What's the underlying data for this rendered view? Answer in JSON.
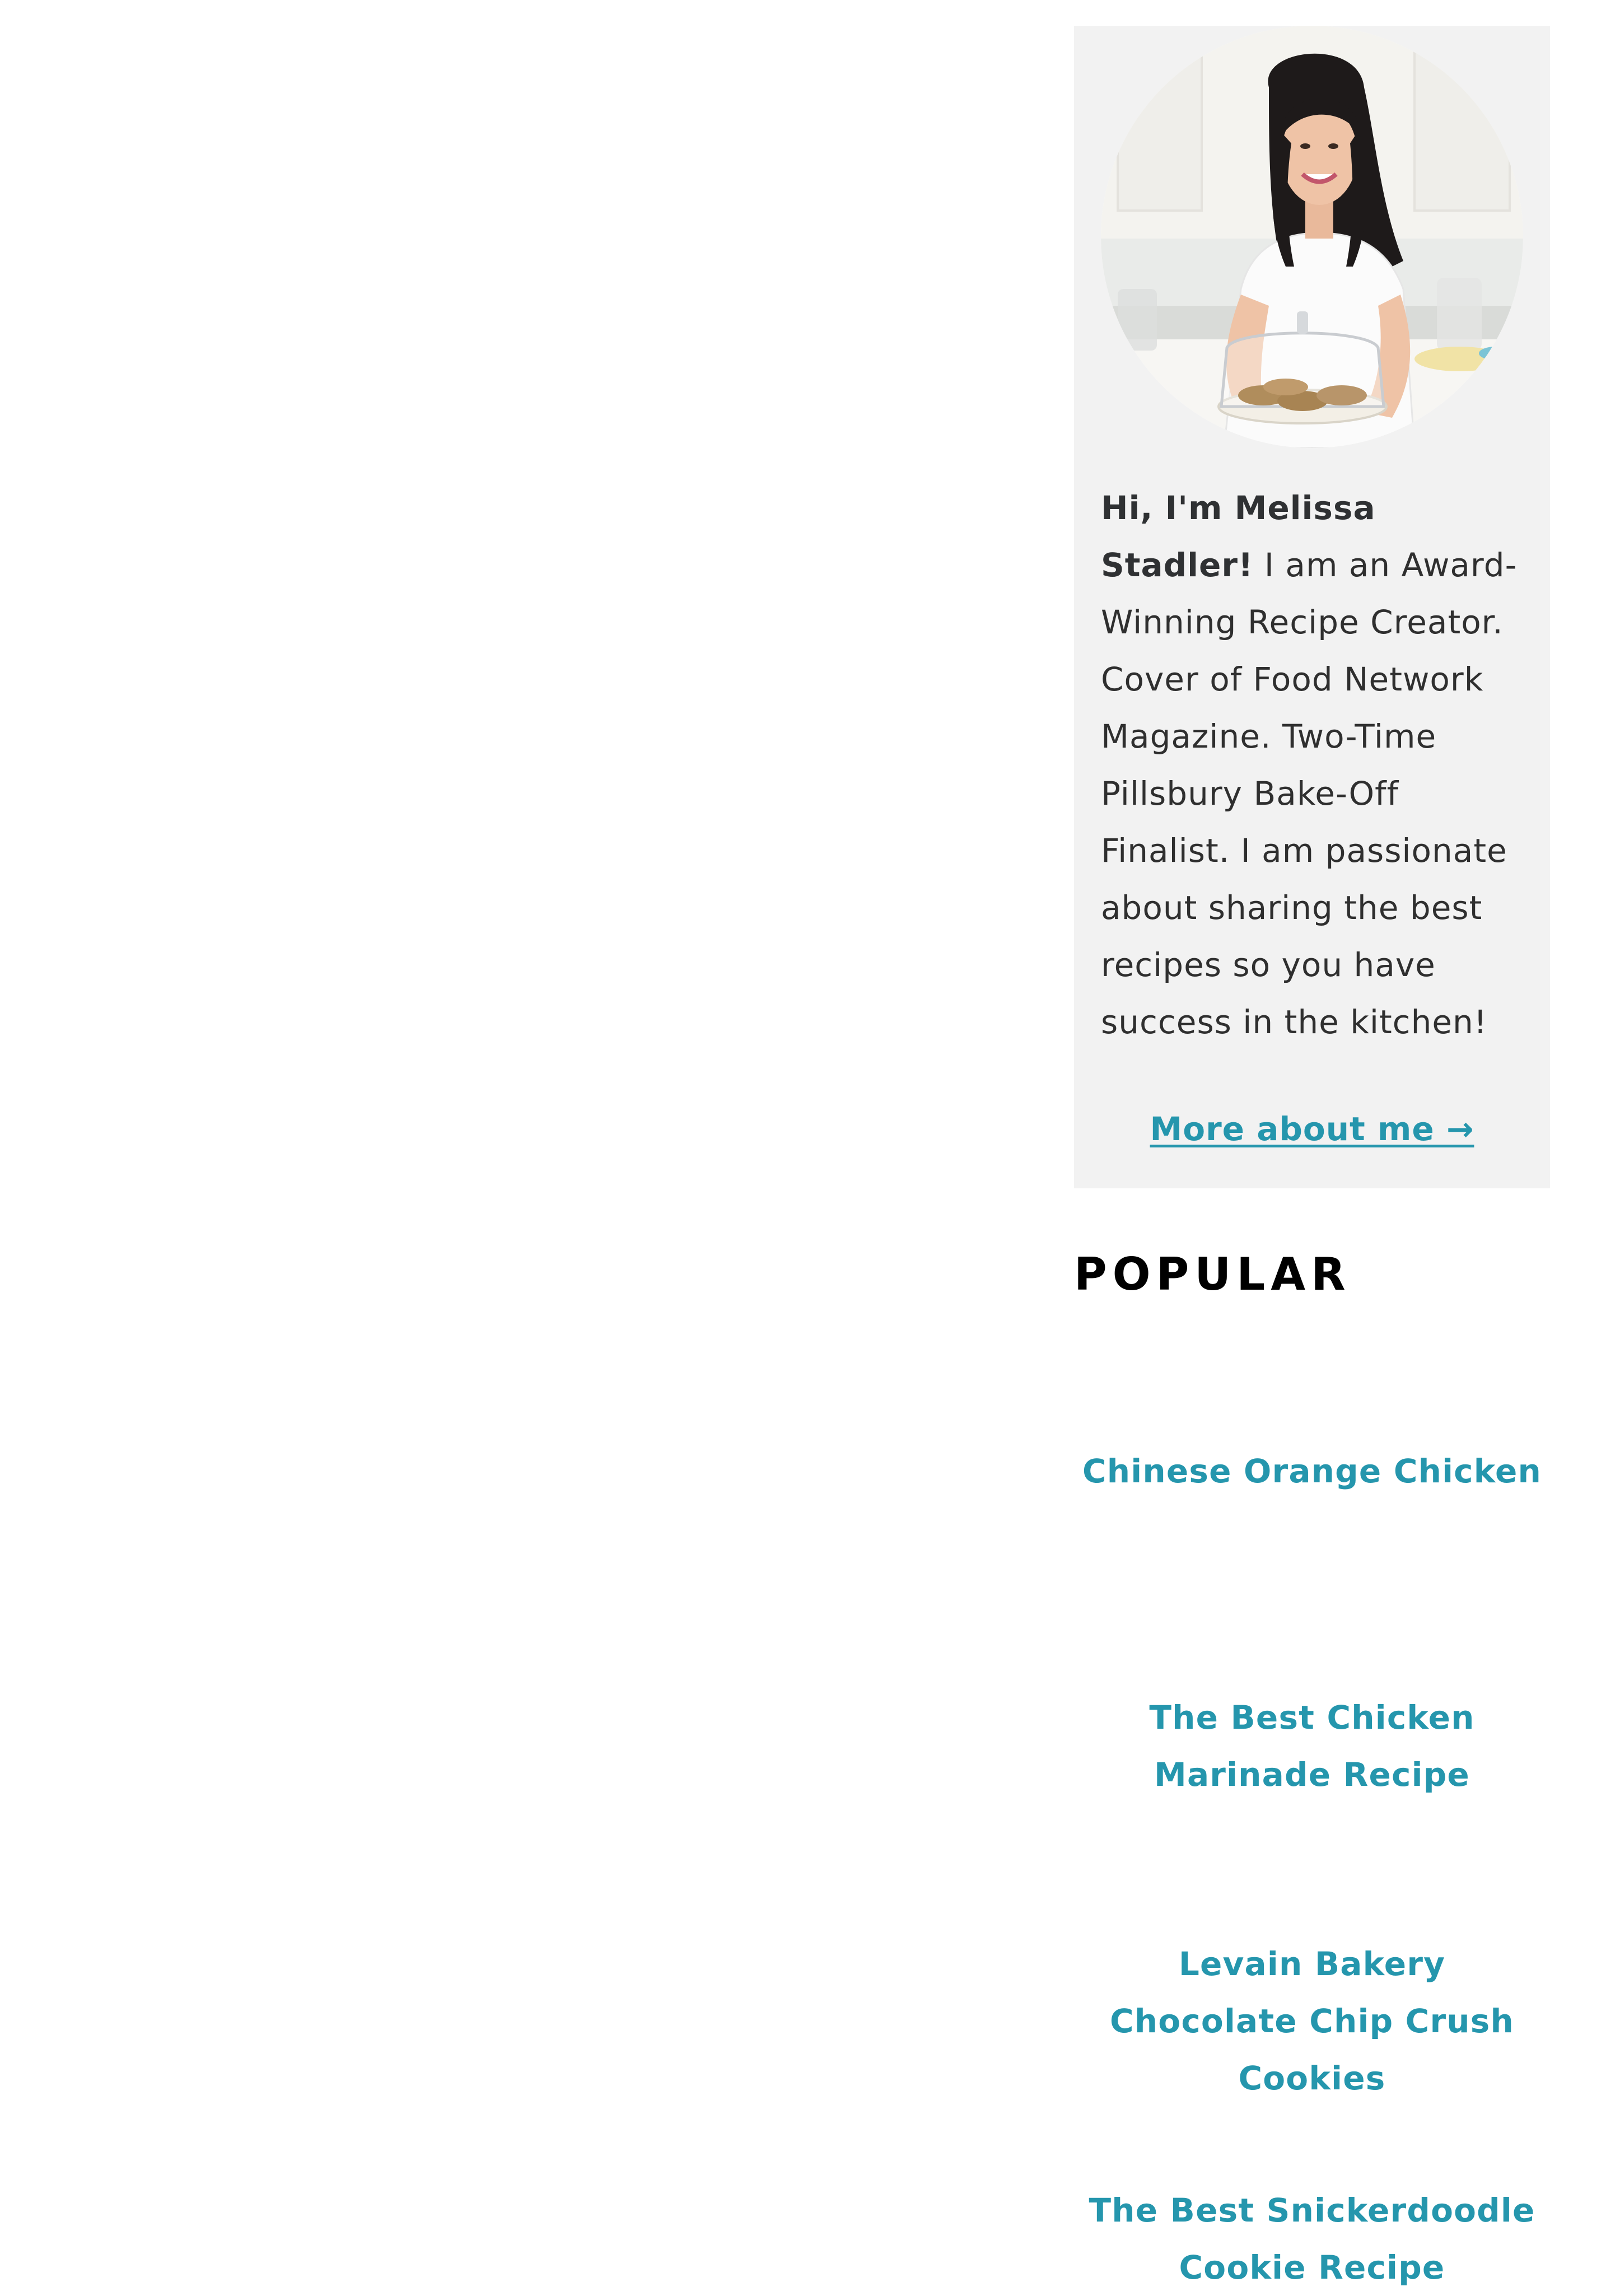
{
  "about": {
    "name_intro": "Hi, I'm Melissa Stadler!",
    "bio": " I am an Award-Winning Recipe Creator. Cover of Food Network Magazine. Two-Time Pillsbury Bake-Off Finalist. I am passionate about sharing the best recipes so you have success in the kitchen!",
    "more_link": "More about me →",
    "card_background": "#f2f2f2",
    "link_color": "#2596ad"
  },
  "popular": {
    "heading": "POPULAR",
    "items": [
      {
        "label": "Chinese Orange Chicken"
      },
      {
        "label": "The Best Chicken Marinade Recipe"
      },
      {
        "label": "Levain Bakery Chocolate Chip Crush Cookies"
      },
      {
        "label": "The Best Snickerdoodle Cookie Recipe"
      }
    ]
  }
}
